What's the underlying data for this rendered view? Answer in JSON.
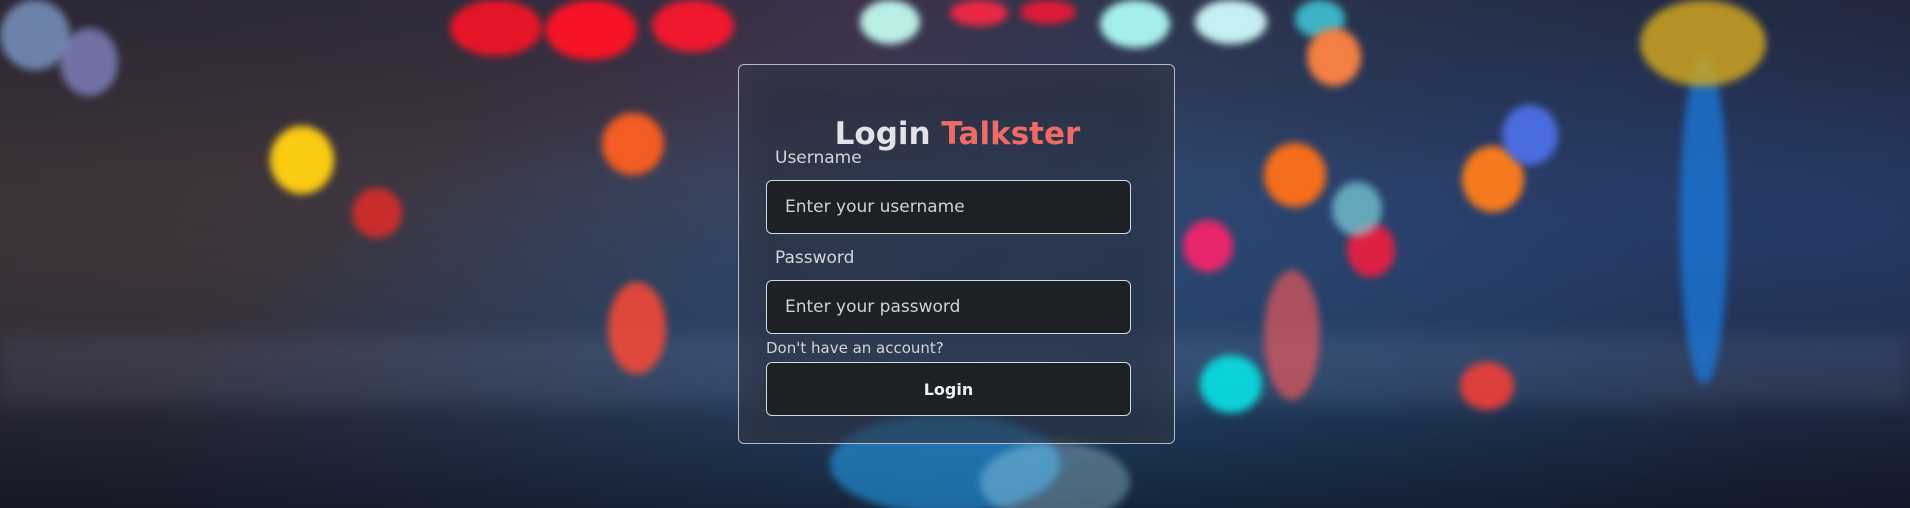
{
  "login": {
    "title_prefix": "Login",
    "brand": "Talkster",
    "username_label": "Username",
    "username_placeholder": "Enter your username",
    "password_label": "Password",
    "password_placeholder": "Enter your password",
    "signup_prompt": "Don't have an account?",
    "submit_label": "Login"
  },
  "colors": {
    "brand": "#EE6B67",
    "card_border": "#D4DAE2",
    "input_background": "#1D2025",
    "text": "#E2E2E7"
  }
}
